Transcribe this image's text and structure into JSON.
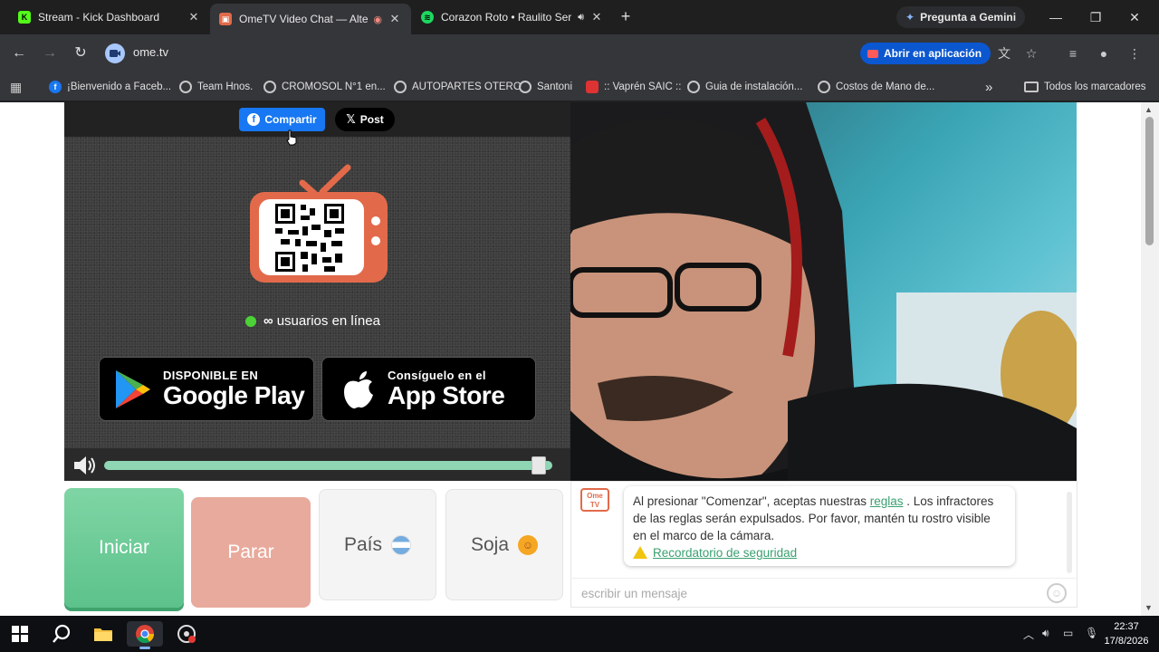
{
  "browser": {
    "tabs": [
      {
        "title": "Stream - Kick Dashboard",
        "icon": "kick-icon",
        "active": false
      },
      {
        "title": "OmeTV Video Chat — Alter",
        "icon": "ometv-icon",
        "active": true
      },
      {
        "title": "Corazon Roto • Raulito Ser",
        "icon": "spotify-icon",
        "active": false
      }
    ],
    "new_tab": "+",
    "gemini_label": "Pregunta a Gemini",
    "url": "ome.tv",
    "open_app_label": "Abrir en aplicación",
    "window_controls": {
      "minimize": "—",
      "restore": "❐",
      "close": "✕"
    }
  },
  "bookmarks": {
    "items": [
      {
        "label": "¡Bienvenido a Faceb...",
        "icon": "facebook-icon"
      },
      {
        "label": "Team Hnos.",
        "icon": "globe-icon"
      },
      {
        "label": "CROMOSOL N°1 en...",
        "icon": "globe-icon"
      },
      {
        "label": "AUTOPARTES OTERO",
        "icon": "globe-icon"
      },
      {
        "label": "Santoni",
        "icon": "globe-icon"
      },
      {
        "label": ":: Vaprén SAIC ::",
        "icon": "vapren-icon"
      },
      {
        "label": "Guia de instalación...",
        "icon": "globe-icon"
      },
      {
        "label": "Costos de Mano de...",
        "icon": "globe-icon"
      }
    ],
    "overflow": "»",
    "all_bookmarks": "Todos los marcadores"
  },
  "page": {
    "share": {
      "facebook_label": "Compartir",
      "x_label": "Post"
    },
    "online": {
      "count": "∞",
      "label": "usuarios en línea"
    },
    "stores": {
      "google": {
        "small": "DISPONIBLE EN",
        "big": "Google Play"
      },
      "apple": {
        "small": "Consíguelo en el",
        "big": "App Store"
      }
    },
    "volume_level": 0.97,
    "buttons": {
      "start": "Iniciar",
      "stop": "Parar",
      "country": "País",
      "gender": "Soja"
    },
    "chat": {
      "logo_top": "Ome",
      "logo_bottom": "TV",
      "notice_before": "Al presionar \"Comenzar\", aceptas nuestras ",
      "rules_link": "reglas",
      "notice_after": " . Los infractores de las reglas serán expulsados. Por favor, mantén tu rostro visible en el marco de la cámara.",
      "safety_link": "Recordatorio de seguridad",
      "placeholder": "escribir un mensaje"
    }
  },
  "taskbar": {
    "time": "22:37",
    "date": "17/8/2026"
  },
  "colors": {
    "start": "#6ccb97",
    "stop": "#e8aa9c",
    "facebook": "#1877f2",
    "accent_green": "#4cd137",
    "ometv_orange": "#e26a4a"
  }
}
